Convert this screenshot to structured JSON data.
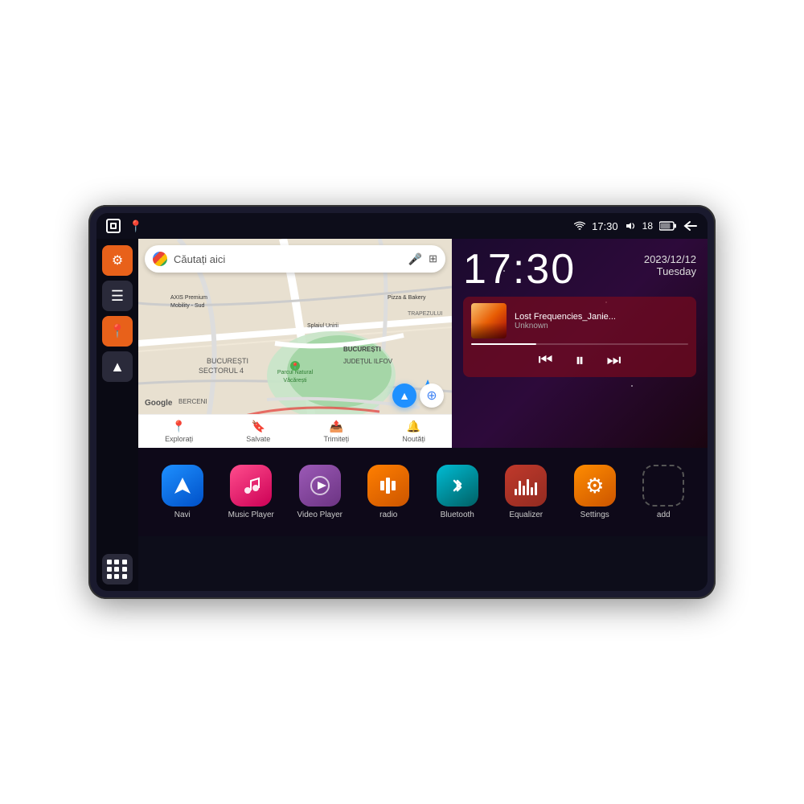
{
  "device": {
    "status_bar": {
      "wifi_icon": "wifi",
      "time": "17:30",
      "volume_icon": "volume",
      "battery_level": "18",
      "battery_icon": "battery",
      "back_icon": "back"
    },
    "sidebar": {
      "items": [
        {
          "id": "settings",
          "icon": "⚙",
          "style": "orange",
          "label": "Settings"
        },
        {
          "id": "files",
          "icon": "▬",
          "style": "dark",
          "label": "Files"
        },
        {
          "id": "maps",
          "icon": "📍",
          "style": "orange",
          "label": "Maps"
        },
        {
          "id": "navigation",
          "icon": "▲",
          "style": "dark",
          "label": "Navigation"
        },
        {
          "id": "apps",
          "icon": "⋮⋮⋮",
          "style": "dark",
          "label": "Apps"
        }
      ]
    },
    "map": {
      "search_placeholder": "Căutați aici",
      "tabs": [
        {
          "id": "explore",
          "label": "Explorați",
          "icon": "📍"
        },
        {
          "id": "saved",
          "label": "Salvate",
          "icon": "🔖"
        },
        {
          "id": "share",
          "label": "Trimiteți",
          "icon": "📤"
        },
        {
          "id": "news",
          "label": "Noutăți",
          "icon": "🔔"
        }
      ],
      "places": [
        "AXIS Premium Mobility - Sud",
        "Pizza & Bakery",
        "Parcul Natural Văcărești",
        "BUCUREȘTI",
        "SECTORUL 4",
        "JUDEȚUL ILFOV",
        "BERCENI",
        "TRAPEZULUI"
      ]
    },
    "clock": {
      "time": "17:30",
      "date": "2023/12/12",
      "day": "Tuesday"
    },
    "music": {
      "title": "Lost Frequencies_Janie...",
      "artist": "Unknown",
      "progress": 30
    },
    "apps": [
      {
        "id": "navi",
        "label": "Navi",
        "style": "blue",
        "icon": "arrow"
      },
      {
        "id": "music-player",
        "label": "Music Player",
        "style": "pink",
        "icon": "music"
      },
      {
        "id": "video-player",
        "label": "Video Player",
        "style": "purple",
        "icon": "play"
      },
      {
        "id": "radio",
        "label": "radio",
        "style": "orange",
        "icon": "radio"
      },
      {
        "id": "bluetooth",
        "label": "Bluetooth",
        "style": "teal",
        "icon": "bluetooth"
      },
      {
        "id": "equalizer",
        "label": "Equalizer",
        "style": "dark-red",
        "icon": "equalizer"
      },
      {
        "id": "settings",
        "label": "Settings",
        "style": "gear",
        "icon": "gear"
      },
      {
        "id": "add",
        "label": "add",
        "style": "add-box",
        "icon": "add"
      }
    ]
  }
}
